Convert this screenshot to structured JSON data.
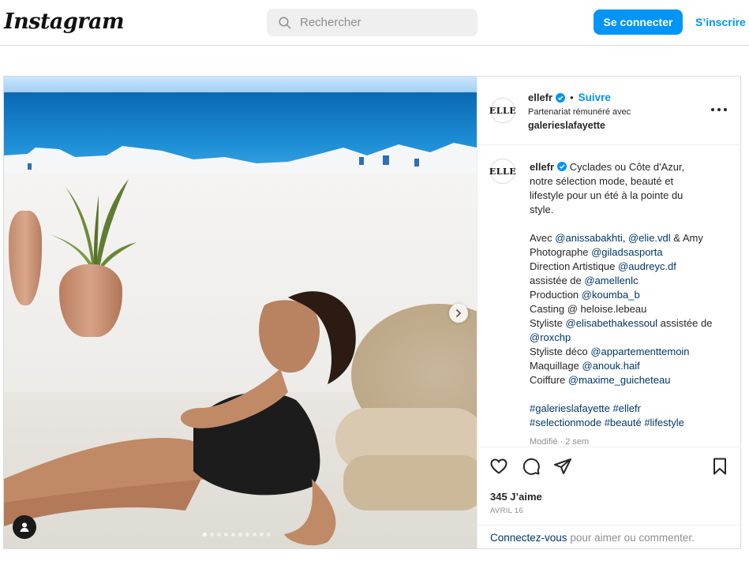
{
  "app": {
    "logo": "Instagram",
    "search_placeholder": "Rechercher",
    "login_label": "Se connecter",
    "signup_label": "S’inscrire"
  },
  "post": {
    "author": "ellefr",
    "author_avatar_text": "ELLE",
    "follow_label": "Suivre",
    "partner_label": "Partenariat rémunéré avec",
    "partner_name": "galerieslafayette",
    "caption": {
      "intro_1": " Cyclades ou Côte d'Azur,",
      "intro_2": "notre sélection mode, beauté et",
      "intro_3": "lifestyle pour un été à la pointe du",
      "intro_4": "style.",
      "avec_prefix": "Avec ",
      "avec_m1": "@anissabakhti",
      "avec_sep": ", ",
      "avec_m2": "@elie.vdl",
      "avec_suffix": " & Amy",
      "photo_prefix": "Photographe ",
      "photo_m": "@giladsasporta",
      "da_prefix": "Direction Artistique ",
      "da_m": "@audreyc.df",
      "assist_prefix": "assistée de ",
      "assist_m": "@amellenlc",
      "prod_prefix": "Production ",
      "prod_m": "@koumba_b",
      "casting": "Casting @ heloise.lebeau",
      "styl_prefix": "Styliste ",
      "styl_m": "@elisabethakessoul",
      "styl_suffix": " assistée de",
      "styl_m2": "@roxchp",
      "deco_prefix": "Styliste déco ",
      "deco_m": "@appartementtemoin",
      "makeup_prefix": "Maquillage ",
      "makeup_m": "@anouk.haif",
      "hair_prefix": "Coiffure ",
      "hair_m": "@maxime_guicheteau",
      "tag1": "#galerieslafayette",
      "tag2": "#ellefr",
      "tag3": "#selectionmode",
      "tag4": "#beauté",
      "tag5": "#lifestyle",
      "modified": "Modifié · 2 sem"
    },
    "likes": "345 J’aime",
    "date": "AVRIL 16",
    "comment_link": "Connectez-vous",
    "comment_rest": " pour aimer ou commenter.",
    "carousel": {
      "count": 10,
      "active_index": 0
    }
  },
  "icons": {
    "search": "search-icon",
    "verified": "verified-badge-icon",
    "more": "more-options-icon",
    "like": "heart-icon",
    "comment": "comment-icon",
    "share": "share-icon",
    "save": "bookmark-icon",
    "next": "chevron-right-icon",
    "tag": "user-tag-icon"
  },
  "colors": {
    "accent": "#0095f6",
    "mention": "#00376b",
    "muted": "#8e8e8e",
    "border": "#dbdbdb"
  }
}
